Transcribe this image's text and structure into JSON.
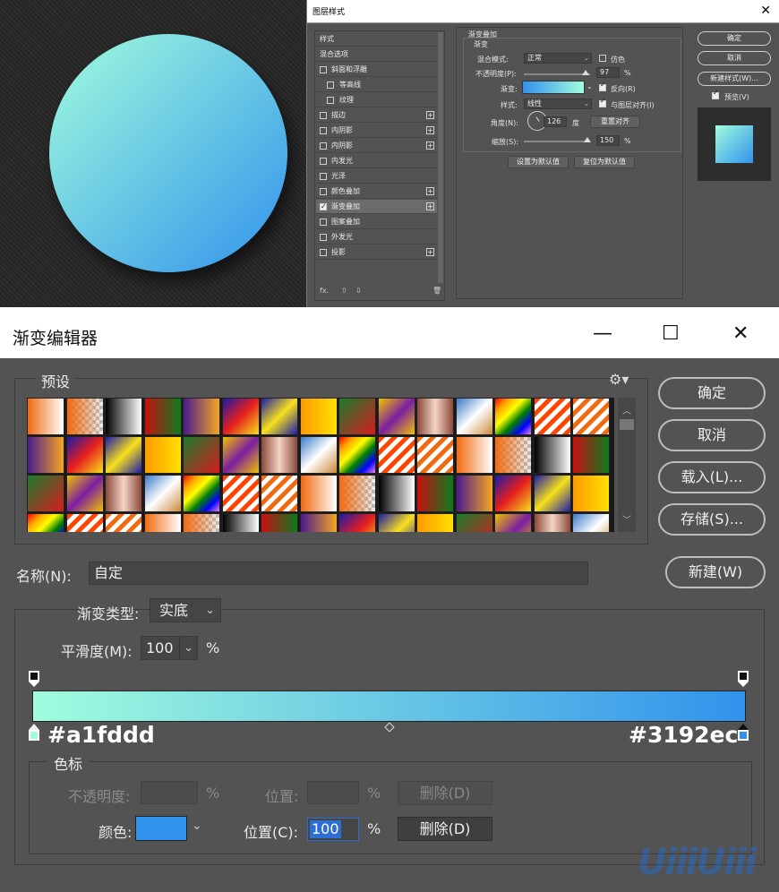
{
  "layer_style": {
    "title": "图层样式",
    "sidebar": [
      {
        "label": "样式",
        "cb": false,
        "plus": false,
        "header": true
      },
      {
        "label": "混合选项",
        "cb": false,
        "plus": false,
        "header": true
      },
      {
        "label": "斜面和浮雕",
        "cb": "off",
        "plus": false
      },
      {
        "label": "等高线",
        "cb": "off",
        "plus": false,
        "indent": true
      },
      {
        "label": "纹理",
        "cb": "off",
        "plus": false,
        "indent": true
      },
      {
        "label": "描边",
        "cb": "off",
        "plus": true
      },
      {
        "label": "内阴影",
        "cb": "off",
        "plus": true
      },
      {
        "label": "内阴影",
        "cb": "off",
        "plus": true
      },
      {
        "label": "内发光",
        "cb": "off",
        "plus": false
      },
      {
        "label": "光泽",
        "cb": "off",
        "plus": false
      },
      {
        "label": "颜色叠加",
        "cb": "off",
        "plus": true
      },
      {
        "label": "渐变叠加",
        "cb": "on",
        "plus": true,
        "selected": true
      },
      {
        "label": "图案叠加",
        "cb": "off",
        "plus": false
      },
      {
        "label": "外发光",
        "cb": "off",
        "plus": false
      },
      {
        "label": "投影",
        "cb": "off",
        "plus": true
      }
    ],
    "footer": {
      "fx": "fx.",
      "up": "⇧",
      "down": "⇩",
      "trash": "🗑"
    },
    "section_title": "渐变叠加",
    "group_title": "渐变",
    "blend_mode_label": "混合模式:",
    "blend_mode_value": "正常",
    "dither_label": "仿色",
    "opacity_label": "不透明度(P):",
    "opacity_value": "97",
    "percent": "%",
    "gradient_label": "渐变:",
    "reverse_label": "反向(R)",
    "style_label": "样式:",
    "style_value": "线性",
    "align_label": "与图层对齐(I)",
    "angle_label": "角度(N):",
    "angle_value": "126",
    "degree": "度",
    "reset_align": "重置对齐",
    "scale_label": "缩放(S):",
    "scale_value": "150",
    "set_default": "设置为默认值",
    "reset_default": "复位为默认值",
    "ok": "确定",
    "cancel": "取消",
    "new_style": "新建样式(W)...",
    "preview": "预览(V)"
  },
  "gradient_editor": {
    "title": "渐变编辑器",
    "minimize": "—",
    "maximize": "☐",
    "close": "✕",
    "presets_label": "预设",
    "ok": "确定",
    "cancel": "取消",
    "load": "载入(L)...",
    "save": "存储(S)...",
    "name_label": "名称(N):",
    "name_value": "自定",
    "new": "新建(W)",
    "type_label": "渐变类型:",
    "type_value": "实底",
    "smooth_label": "平滑度(M):",
    "smooth_value": "100",
    "percent": "%",
    "stop_left_hex": "#a1fddd",
    "stop_right_hex": "#3192ec",
    "stops_label": "色标",
    "opacity_label": "不透明度:",
    "position_label": "位置:",
    "delete_label": "删除(D)",
    "color_label": "颜色:",
    "position_c_label": "位置(C):",
    "position_c_value": "100"
  },
  "colors": {
    "start": "#a1fddd",
    "end": "#3192ec",
    "panel": "#535353"
  },
  "watermark": "UiiiUiii"
}
